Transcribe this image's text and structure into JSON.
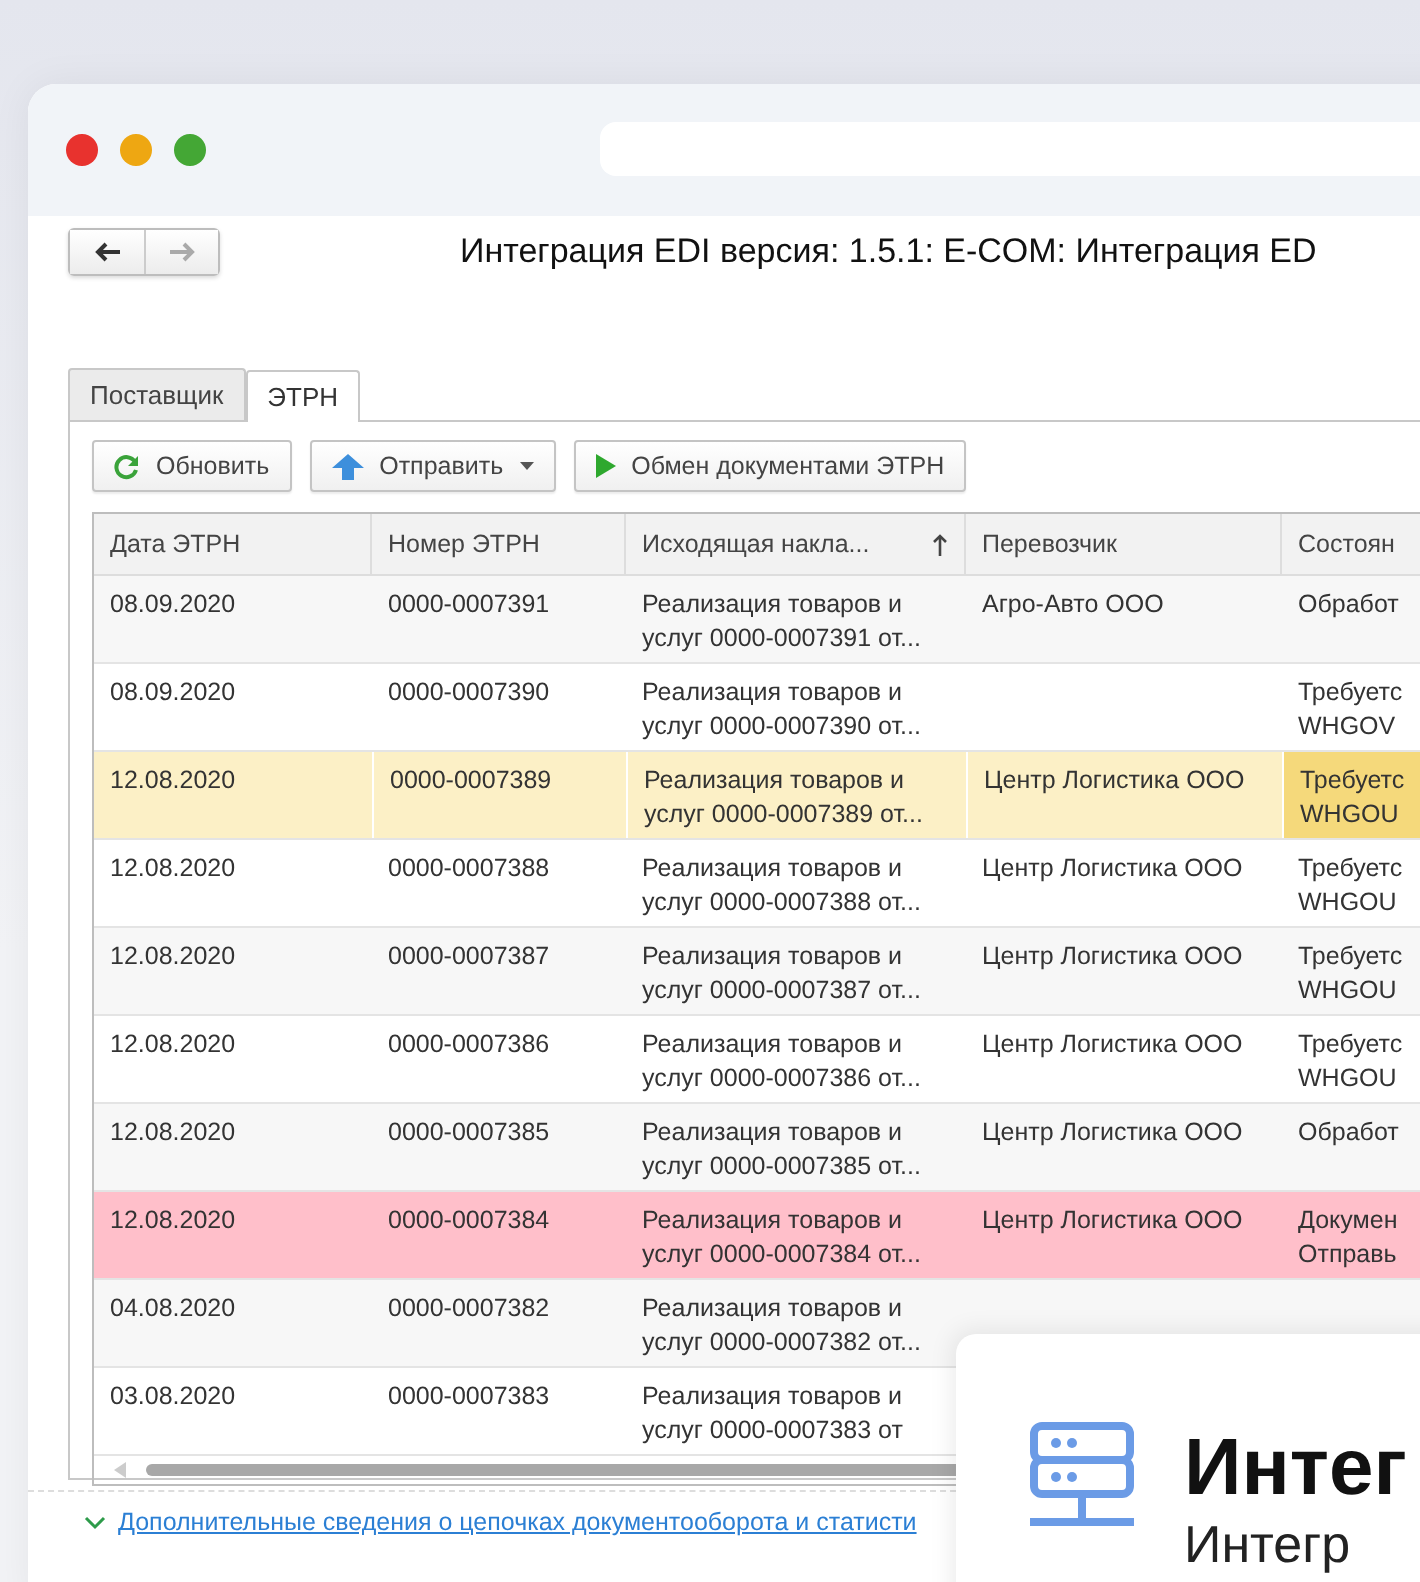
{
  "window": {
    "title": "Интеграция EDI версия: 1.5.1: E-COM: Интеграция ED"
  },
  "tabs": [
    {
      "label": "Поставщик",
      "selected": false
    },
    {
      "label": "ЭТРН",
      "selected": true
    }
  ],
  "toolbar": [
    {
      "label": "Обновить",
      "kind": "refresh",
      "has_menu": false
    },
    {
      "label": "Отправить",
      "kind": "send",
      "has_menu": true
    },
    {
      "label": "Обмен документами ЭТРН",
      "kind": "run",
      "has_menu": false
    }
  ],
  "table": {
    "columns": [
      {
        "label": "Дата ЭТРН",
        "sorted": false
      },
      {
        "label": "Номер ЭТРН",
        "sorted": false
      },
      {
        "label": "Исходящая накла...",
        "sorted": true
      },
      {
        "label": "Перевозчик",
        "sorted": false
      },
      {
        "label": "Состоян"
      }
    ],
    "rows": [
      {
        "date": "08.09.2020",
        "number": "0000-0007391",
        "document": [
          "Реализация товаров и",
          "услуг 0000-0007391 от..."
        ],
        "carrier": "Агро-Авто ООО",
        "status": [
          "Обработ"
        ],
        "kind": "normal",
        "selected": false
      },
      {
        "date": "08.09.2020",
        "number": "0000-0007390",
        "document": [
          "Реализация товаров и",
          "услуг 0000-0007390 от..."
        ],
        "carrier": "",
        "status": [
          "Требуетс",
          "WHGOV"
        ],
        "kind": "normal",
        "selected": false
      },
      {
        "date": "12.08.2020",
        "number": "0000-0007389",
        "document": [
          "Реализация товаров и",
          "услуг 0000-0007389 от..."
        ],
        "carrier": "Центр Логистика ООО",
        "status": [
          "Требуетс",
          "WHGOU"
        ],
        "kind": "normal",
        "selected": true
      },
      {
        "date": "12.08.2020",
        "number": "0000-0007388",
        "document": [
          "Реализация товаров и",
          "услуг 0000-0007388 от..."
        ],
        "carrier": "Центр Логистика ООО",
        "status": [
          "Требуетс",
          "WHGOU"
        ],
        "kind": "normal",
        "selected": false
      },
      {
        "date": "12.08.2020",
        "number": "0000-0007387",
        "document": [
          "Реализация товаров и",
          "услуг 0000-0007387 от..."
        ],
        "carrier": "Центр Логистика ООО",
        "status": [
          "Требуетс",
          "WHGOU"
        ],
        "kind": "normal",
        "selected": false
      },
      {
        "date": "12.08.2020",
        "number": "0000-0007386",
        "document": [
          "Реализация товаров и",
          "услуг 0000-0007386 от..."
        ],
        "carrier": "Центр Логистика ООО",
        "status": [
          "Требуетс",
          "WHGOU"
        ],
        "kind": "normal",
        "selected": false
      },
      {
        "date": "12.08.2020",
        "number": "0000-0007385",
        "document": [
          "Реализация товаров и",
          "услуг 0000-0007385 от..."
        ],
        "carrier": "Центр Логистика ООО",
        "status": [
          "Обработ"
        ],
        "kind": "normal",
        "selected": false
      },
      {
        "date": "12.08.2020",
        "number": "0000-0007384",
        "document": [
          "Реализация товаров и",
          "услуг 0000-0007384 от..."
        ],
        "carrier": "Центр Логистика ООО",
        "status": [
          "Докумен",
          "Отправь"
        ],
        "kind": "error",
        "selected": false
      },
      {
        "date": "04.08.2020",
        "number": "0000-0007382",
        "document": [
          "Реализация товаров и",
          "услуг 0000-0007382 от..."
        ],
        "carrier": "",
        "status": [],
        "kind": "normal",
        "selected": false
      },
      {
        "date": "03.08.2020",
        "number": "0000-0007383",
        "document": [
          "Реализация товаров и",
          "услуг 0000-0007383 от"
        ],
        "carrier": "",
        "status": [],
        "kind": "normal",
        "selected": false
      }
    ]
  },
  "details_link": {
    "label": "Дополнительные сведения о цепочках документооборота и статисти",
    "expanded": false
  },
  "promo_card": {
    "title": "Интег",
    "subtitle": "Интегр"
  }
}
